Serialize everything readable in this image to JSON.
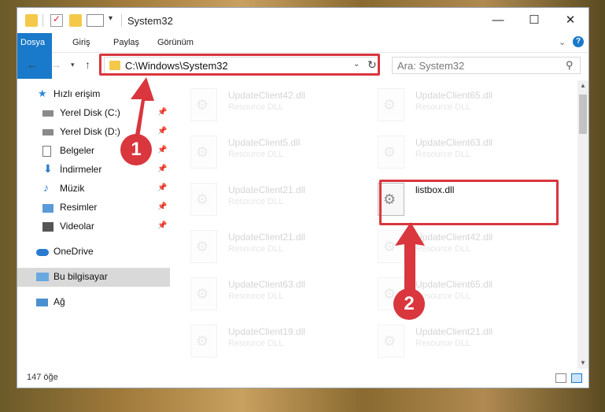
{
  "titlebar": {
    "title": "System32"
  },
  "ribbon": {
    "tabs": [
      "Dosya",
      "Giriş",
      "Paylaş",
      "Görünüm"
    ],
    "help": "?"
  },
  "nav": {
    "address": "C:\\Windows\\System32",
    "search_placeholder": "Ara: System32"
  },
  "sidebar": {
    "items": [
      {
        "label": "Hızlı erişim",
        "icon": "star-icon"
      },
      {
        "label": "Yerel Disk (C:)",
        "icon": "drive-icon"
      },
      {
        "label": "Yerel Disk (D:)",
        "icon": "drive-icon"
      },
      {
        "label": "Belgeler",
        "icon": "document-icon"
      },
      {
        "label": "İndirmeler",
        "icon": "download-icon"
      },
      {
        "label": "Müzik",
        "icon": "music-icon"
      },
      {
        "label": "Resimler",
        "icon": "pictures-icon"
      },
      {
        "label": "Videolar",
        "icon": "video-icon"
      },
      {
        "label": "OneDrive",
        "icon": "cloud-icon"
      },
      {
        "label": "Bu bilgisayar",
        "icon": "computer-icon"
      },
      {
        "label": "Ağ",
        "icon": "network-icon"
      }
    ]
  },
  "files": [
    {
      "name": "UpdateClient42.dll",
      "type": "Resource DLL"
    },
    {
      "name": "UpdateClient65.dll",
      "type": "Resource DLL"
    },
    {
      "name": "UpdateClient5.dll",
      "type": "Resource DLL"
    },
    {
      "name": "UpdateClient63.dll",
      "type": "Resource DLL"
    },
    {
      "name": "UpdateClient21.dll",
      "type": "Resource DLL"
    },
    {
      "name": "listbox.dll",
      "type": ""
    },
    {
      "name": "UpdateClient21.dll",
      "type": "Resource DLL"
    },
    {
      "name": "UpdateClient42.dll",
      "type": "Resource DLL"
    },
    {
      "name": "UpdateClient63.dll",
      "type": "Resource DLL"
    },
    {
      "name": "UpdateClient65.dll",
      "type": "Resource DLL"
    },
    {
      "name": "UpdateClient19.dll",
      "type": "Resource DLL"
    },
    {
      "name": "UpdateClient21.dll",
      "type": "Resource DLL"
    }
  ],
  "status": {
    "count": "147 öğe"
  },
  "annotations": {
    "badge1": "1",
    "badge2": "2",
    "color": "#d9363e"
  }
}
